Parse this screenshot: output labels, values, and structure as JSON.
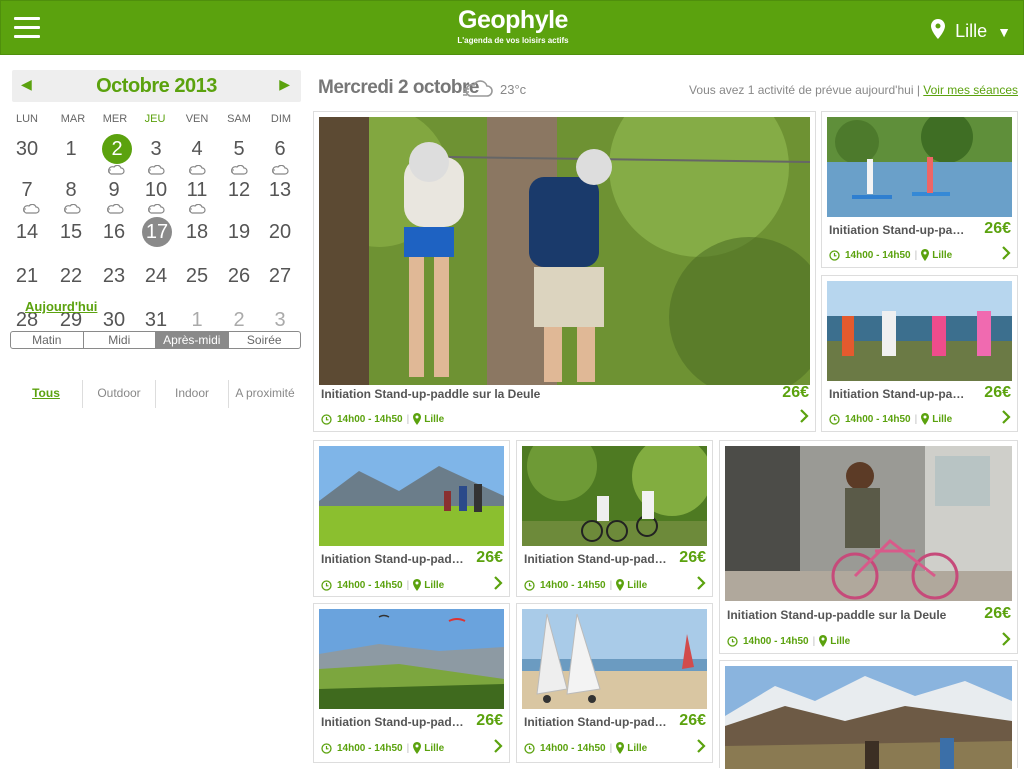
{
  "app": {
    "logo": "Geophyle",
    "tagline": "L'agenda de vos loisirs actifs",
    "location": "Lille"
  },
  "calendar": {
    "month_title": "Octobre 2013",
    "weekdays": [
      "LUN",
      "MAR",
      "MER",
      "JEU",
      "VEN",
      "SAM",
      "DIM"
    ],
    "rows": [
      [
        "30",
        "1",
        "2",
        "3",
        "4",
        "5",
        "6"
      ],
      [
        "7",
        "8",
        "9",
        "10",
        "11",
        "12",
        "13"
      ],
      [
        "14",
        "15",
        "16",
        "17",
        "18",
        "19",
        "20"
      ],
      [
        "21",
        "22",
        "23",
        "24",
        "25",
        "26",
        "27"
      ],
      [
        "28",
        "29",
        "30",
        "31",
        "1",
        "2",
        "3"
      ]
    ],
    "selected_day": "2",
    "highlighted_day": "17",
    "today_link": "Aujourd'hui",
    "periods": [
      "Matin",
      "Midi",
      "Après-midi",
      "Soirée"
    ],
    "active_period": "Après-midi",
    "filters": [
      "Tous",
      "Outdoor",
      "Indoor",
      "A proximité"
    ],
    "active_filter": "Tous"
  },
  "main": {
    "day_title": "Mercredi 2 octobre",
    "weather_icon": "cloudy-icon",
    "temperature": "23°c",
    "notice": "Vous avez 1 activité de prévue aujourd'hui |",
    "notice_link": "Voir mes séances"
  },
  "cards": [
    {
      "title": "Initiation Stand-up-paddle sur la Deule",
      "price": "26€",
      "time": "14h00 - 14h50",
      "place": "Lille"
    },
    {
      "title": "Initiation Stand-up-paddle",
      "price": "26€",
      "time": "14h00 - 14h50",
      "place": "Lille"
    },
    {
      "title": "Initiation Stand-up-paddle",
      "price": "26€",
      "time": "14h00 - 14h50",
      "place": "Lille"
    },
    {
      "title": "Initiation Stand-up-paddle",
      "price": "26€",
      "time": "14h00 - 14h50",
      "place": "Lille"
    },
    {
      "title": "Initiation Stand-up-paddle",
      "price": "26€",
      "time": "14h00 - 14h50",
      "place": "Lille"
    },
    {
      "title": "Initiation Stand-up-paddle sur la Deule",
      "price": "26€",
      "time": "14h00 - 14h50",
      "place": "Lille"
    },
    {
      "title": "Initiation Stand-up-paddle",
      "price": "26€",
      "time": "14h00 - 14h50",
      "place": "Lille"
    },
    {
      "title": "Initiation Stand-up-paddle",
      "price": "26€",
      "time": "14h00 - 14h50",
      "place": "Lille"
    },
    {
      "title": "",
      "price": "",
      "time": "",
      "place": ""
    }
  ],
  "colors": {
    "brand": "#5ba20e",
    "grey_accent": "#8a8a8a"
  }
}
